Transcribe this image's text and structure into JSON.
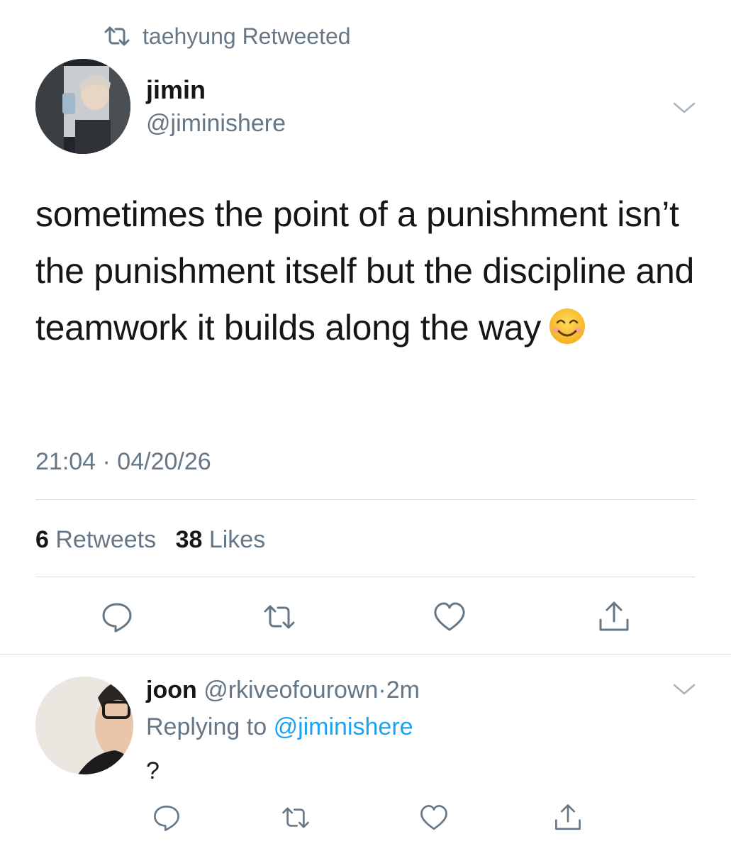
{
  "retweet_context": {
    "text": "taehyung Retweeted",
    "icon": "retweet-icon"
  },
  "tweet": {
    "author_name": "jimin",
    "author_handle": "@jiminishere",
    "text": "sometimes the point of a punishment isn’t the punishment itself but the discipline and teamwork it builds along the way",
    "emoji": "smiling-face-emoji",
    "timestamp": "21:04 · 04/20/26",
    "retweet_count": "6",
    "retweet_label": "Retweets",
    "like_count": "38",
    "like_label": "Likes"
  },
  "reply": {
    "author_name": "joon",
    "author_handle": "@rkiveofourown",
    "separator": "·",
    "time": "2m",
    "replying_prefix": "Replying to",
    "replying_handle": "@jiminishere",
    "text": "?"
  },
  "actions": [
    "reply-icon",
    "retweet-icon",
    "like-icon",
    "share-icon"
  ],
  "colors": {
    "text": "#14171a",
    "secondary": "#657786",
    "link": "#1da1f2",
    "divider": "#d9dee2"
  }
}
